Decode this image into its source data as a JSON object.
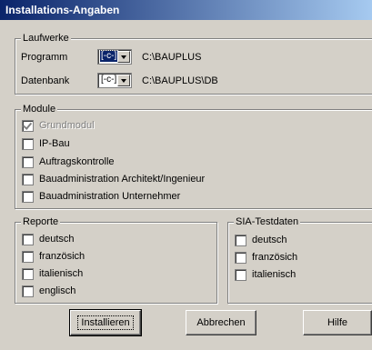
{
  "window": {
    "title": "Installations-Angaben"
  },
  "laufwerke": {
    "legend": "Laufwerke",
    "programm": {
      "label": "Programm",
      "drive": "[-c-]",
      "path": "C:\\BAUPLUS"
    },
    "datenbank": {
      "label": "Datenbank",
      "drive": "[-c-]",
      "path": "C:\\BAUPLUS\\DB"
    }
  },
  "module": {
    "legend": "Module",
    "items": [
      {
        "label": "Grundmodul",
        "checked": true,
        "disabled": true
      },
      {
        "label": "IP-Bau",
        "checked": false
      },
      {
        "label": "Auftragskontrolle",
        "checked": false
      },
      {
        "label": "Bauadministration Architekt/Ingenieur",
        "checked": false
      },
      {
        "label": "Bauadministration Unternehmer",
        "checked": false
      }
    ]
  },
  "reporte": {
    "legend": "Reporte",
    "items": [
      {
        "label": "deutsch"
      },
      {
        "label": "französich"
      },
      {
        "label": "italienisch"
      },
      {
        "label": "englisch"
      }
    ]
  },
  "sia": {
    "legend": "SIA-Testdaten",
    "items": [
      {
        "label": "deutsch"
      },
      {
        "label": "französich"
      },
      {
        "label": "italienisch"
      }
    ]
  },
  "buttons": {
    "install": "Installieren",
    "cancel": "Abbrechen",
    "help": "Hilfe"
  }
}
